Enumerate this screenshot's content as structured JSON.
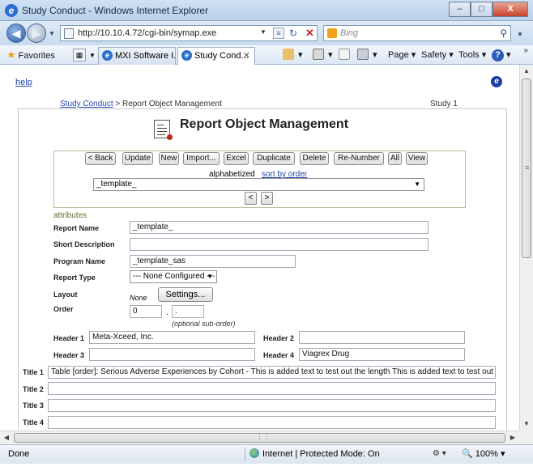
{
  "window": {
    "title": "Study Conduct - Windows Internet Explorer",
    "controls": [
      "–",
      "□",
      "X"
    ]
  },
  "address_bar": {
    "url": "http://10.10.4.72/cgi-bin/symap.exe",
    "search_placeholder": "Bing"
  },
  "favorites_bar": {
    "favorites_label": "Favorites",
    "tabs": [
      {
        "label": "MXI Software I..."
      },
      {
        "label": "Study Cond..."
      }
    ],
    "commands": {
      "page": "Page",
      "safety": "Safety",
      "tools": "Tools"
    }
  },
  "page": {
    "help_link": "help",
    "breadcrumb": {
      "link": "Study Conduct",
      "current": " > Report Object Management"
    },
    "study_label": "Study 1",
    "heading": "Report Object Management",
    "toolbar": {
      "buttons": [
        "< Back",
        "Update",
        "New",
        "Import...",
        "Excel",
        "Duplicate",
        "Delete",
        "Re-Number",
        "All",
        "View"
      ],
      "alphabetized": "alphabetized",
      "sort_link": "sort by order",
      "object_select": "_template_",
      "prev": "<",
      "next": ">"
    },
    "attributes": {
      "section_label": "attributes",
      "report_name_label": "Report Name",
      "report_name": "_template_",
      "short_description_label": "Short Description",
      "short_description": "",
      "program_name_label": "Program Name",
      "program_name": "_template_sas",
      "report_type_label": "Report Type",
      "report_type": "--- None Configured ---",
      "layout_label": "Layout",
      "layout_value": "None",
      "settings_button": "Settings...",
      "order_label": "Order",
      "order": "0",
      "sub_order": ".",
      "order_hint": "(optional sub-order)",
      "header1_label": "Header 1",
      "header1": "Meta-Xceed, Inc.",
      "header2_label": "Header 2",
      "header2": "",
      "header3_label": "Header 3",
      "header3": "",
      "header4_label": "Header 4",
      "header4": "Viagrex Drug",
      "title1_label": "Title 1",
      "title1": "Table [order]: Serious Adverse Experiences by Cohort - This is added text to test out the length  This is added text to test out the length  This is",
      "title2_label": "Title 2",
      "title2": "",
      "title3_label": "Title 3",
      "title3": "",
      "title4_label": "Title 4",
      "title4": ""
    }
  },
  "status_bar": {
    "status": "Done",
    "zone": "Internet | Protected Mode: On",
    "zoom": "100%"
  }
}
